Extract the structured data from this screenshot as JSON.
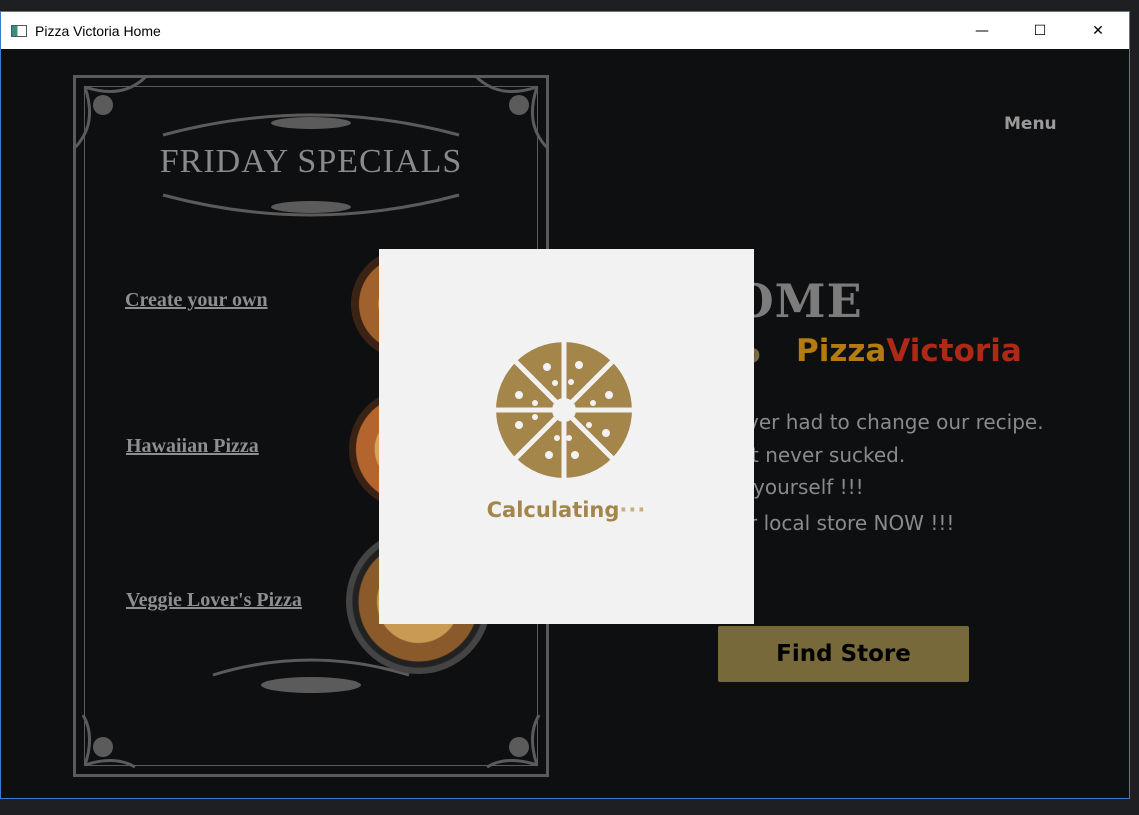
{
  "window": {
    "title": "Pizza Victoria Home",
    "minimize_glyph": "—",
    "maximize_glyph": "☐",
    "close_glyph": "✕"
  },
  "specials": {
    "title": "FRIDAY SPECIALS",
    "items": [
      {
        "label": "Create your own"
      },
      {
        "label": "Hawaiian Pizza"
      },
      {
        "label": "Veggie Lover's Pizza"
      }
    ]
  },
  "nav": {
    "menu_label": "Menu"
  },
  "hero": {
    "welcome": "COME",
    "to": "o",
    "brand_part1": "Pizza",
    "brand_part2": "Victoria",
    "lines": [
      "ver had to change our recipe.",
      "t never sucked.",
      "yourself !!!",
      "r local store NOW !!!"
    ],
    "find_store_label": "Find Store"
  },
  "modal": {
    "loading_text": "Calculating",
    "loading_dots": "···",
    "icon": "pizza-icon"
  },
  "colors": {
    "accent_gold": "#a4854a",
    "brand_orange": "#b57a10",
    "brand_red": "#b02816",
    "button_bg": "#77693a"
  }
}
